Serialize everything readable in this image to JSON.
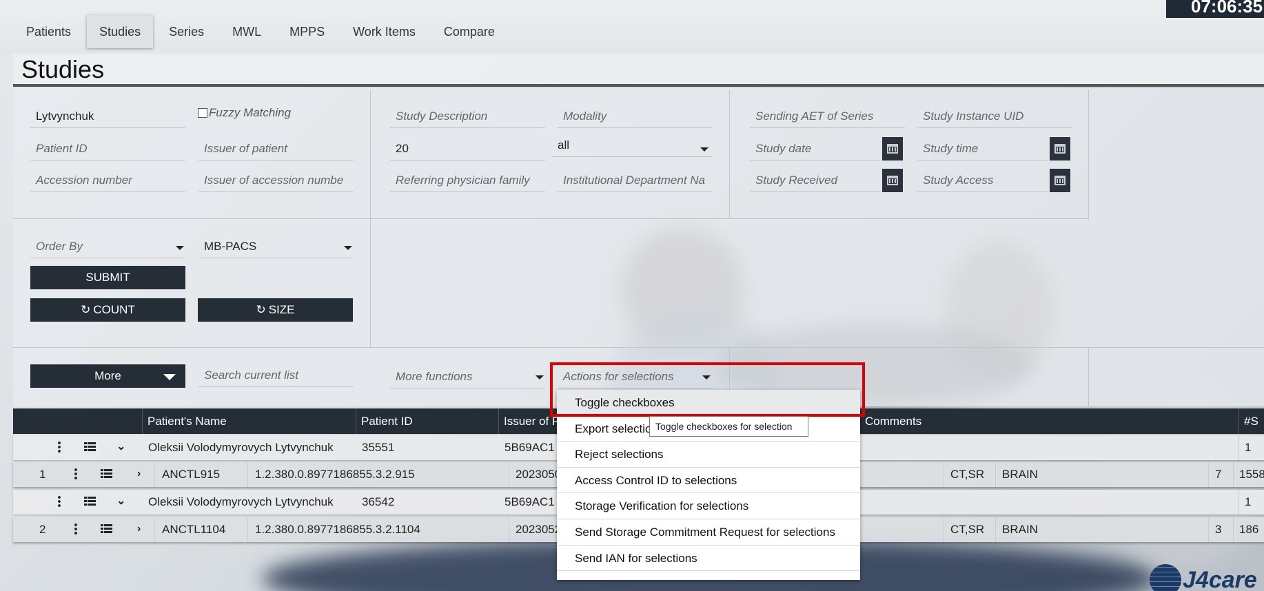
{
  "clock": "07:06:35",
  "tabs": [
    {
      "label": "Patients"
    },
    {
      "label": "Studies"
    },
    {
      "label": "Series"
    },
    {
      "label": "MWL"
    },
    {
      "label": "MPPS"
    },
    {
      "label": "Work Items"
    },
    {
      "label": "Compare"
    }
  ],
  "page_title": "Studies",
  "filters": {
    "patient_name_value": "Lytvynchuk",
    "fuzzy_matching_label": "Fuzzy Matching",
    "patient_id_placeholder": "Patient ID",
    "issuer_of_patient_placeholder": "Issuer of patient",
    "accession_number_placeholder": "Accession number",
    "issuer_of_accession_placeholder": "Issuer of accession numbe",
    "study_description_placeholder": "Study Description",
    "modality_placeholder": "Modality",
    "limit_value": "20",
    "modality_select_value": "all",
    "referring_physician_placeholder": "Referring physician family",
    "institutional_department_placeholder": "Institutional Department Na",
    "sending_aet_placeholder": "Sending AET of Series",
    "study_instance_uid_placeholder": "Study Instance UID",
    "study_date_placeholder": "Study date",
    "study_time_placeholder": "Study time",
    "study_received_placeholder": "Study Received",
    "study_access_placeholder": "Study Access",
    "order_by_placeholder": "Order By",
    "aet_value": "MB-PACS"
  },
  "buttons": {
    "submit": "SUBMIT",
    "count": "COUNT",
    "size": "SIZE",
    "more": "More"
  },
  "list_controls": {
    "search_placeholder": "Search current list",
    "more_functions": "More functions",
    "actions_for_selections": "Actions for selections"
  },
  "table": {
    "headers": {
      "patient_name": "Patient's Name",
      "patient_id": "Patient ID",
      "issuer": "Issuer of P",
      "comments": "Comments",
      "num_series": "#S"
    },
    "rows": [
      {
        "patient_name": "Oleksii Volodymyrovych Lytvynchuk",
        "patient_id": "35551",
        "issuer": "5B69AC1",
        "count": "1"
      },
      {
        "index": "1",
        "accession": "ANCTL915",
        "study_uid": "1.2.380.0.8977186855.3.2.915",
        "date": "2023050",
        "modalities": "CT,SR",
        "description": "BRAIN",
        "num": "7",
        "size": "1558"
      },
      {
        "patient_name": "Oleksii Volodymyrovych Lytvynchuk",
        "patient_id": "36542",
        "issuer": "5B69AC1",
        "count": "1"
      },
      {
        "index": "2",
        "accession": "ANCTL1104",
        "study_uid": "1.2.380.0.8977186855.3.2.1104",
        "date": "2023052",
        "modalities": "CT,SR",
        "description": "BRAIN",
        "num": "3",
        "size": "186"
      }
    ]
  },
  "dropdown": {
    "items": [
      "Toggle checkboxes",
      "Export selections",
      "Reject selections",
      "Access Control ID to selections",
      "Storage Verification for selections",
      "Send Storage Commitment Request for selections",
      "Send IAN for selections",
      ""
    ],
    "tooltip": "Toggle checkboxes for selection"
  },
  "logo_text": "J4care"
}
